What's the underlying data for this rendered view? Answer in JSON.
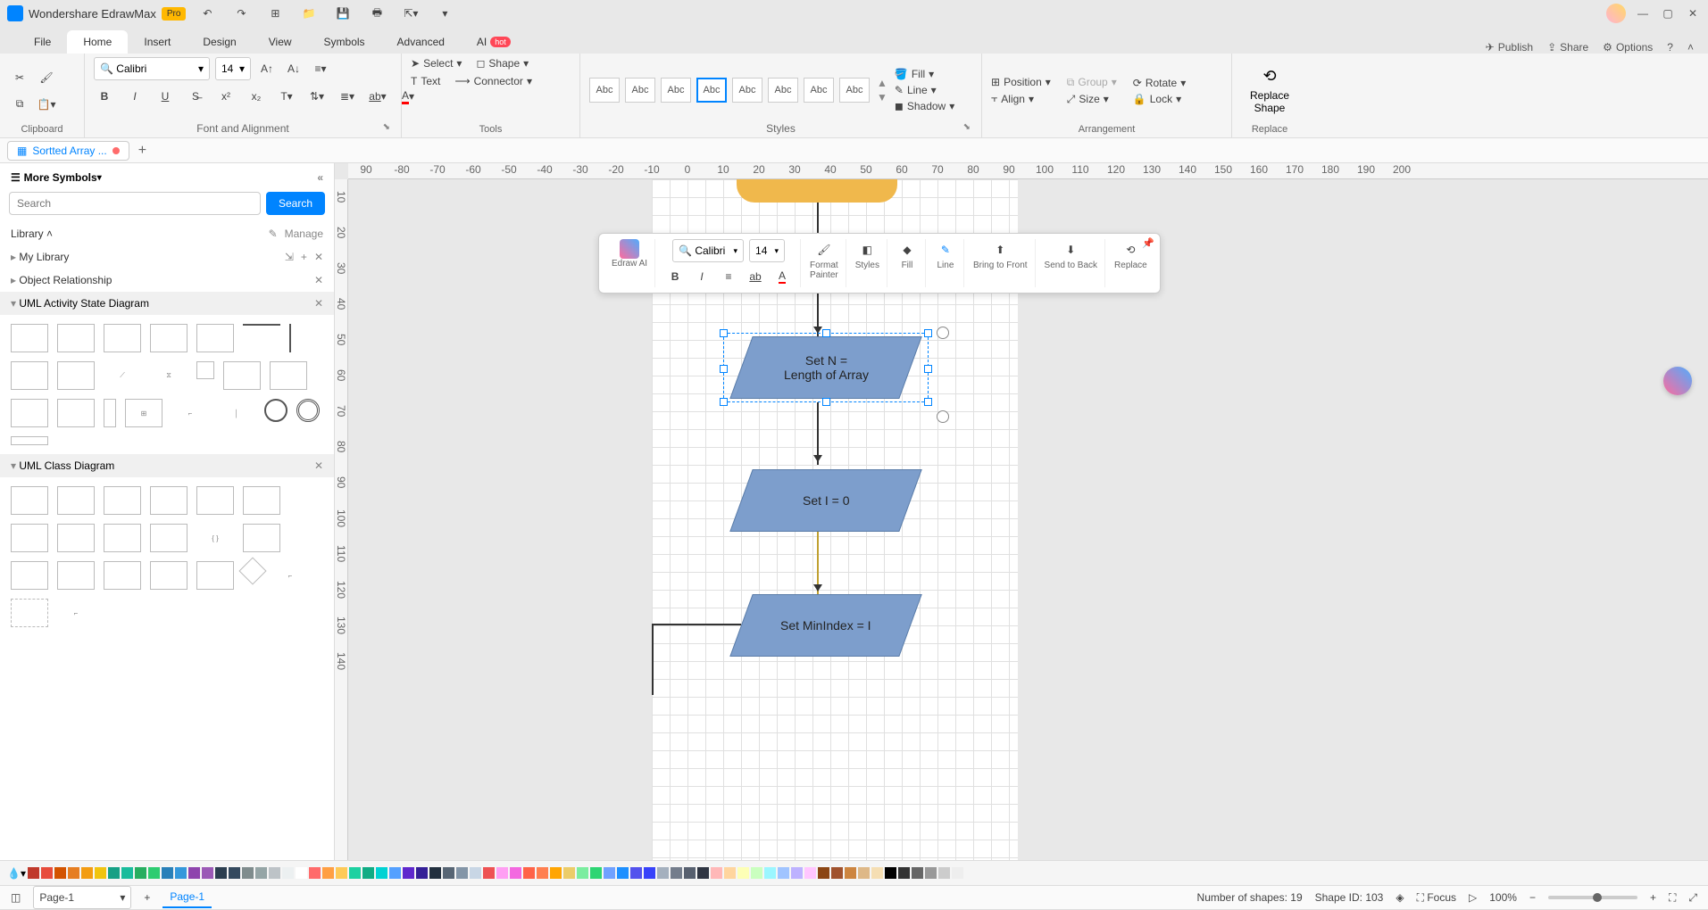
{
  "titlebar": {
    "app_name": "Wondershare EdrawMax",
    "pro": "Pro"
  },
  "menu": {
    "file": "File",
    "home": "Home",
    "insert": "Insert",
    "design": "Design",
    "view": "View",
    "symbols": "Symbols",
    "advanced": "Advanced",
    "ai": "AI",
    "hot": "hot",
    "publish": "Publish",
    "share": "Share",
    "options": "Options"
  },
  "ribbon": {
    "clipboard_label": "Clipboard",
    "font_alignment_label": "Font and Alignment",
    "tools_label": "Tools",
    "styles_label": "Styles",
    "arrangement_label": "Arrangement",
    "replace_label": "Replace",
    "font_name": "Calibri",
    "font_size": "14",
    "select": "Select",
    "text": "Text",
    "shape": "Shape",
    "connector": "Connector",
    "abc": "Abc",
    "fill": "Fill",
    "line": "Line",
    "shadow": "Shadow",
    "position": "Position",
    "align": "Align",
    "group": "Group",
    "size": "Size",
    "rotate": "Rotate",
    "lock": "Lock",
    "replace_shape": "Replace\nShape"
  },
  "doctab": {
    "name": "Sortted Array ..."
  },
  "sidebar": {
    "more_symbols": "More Symbols",
    "search_placeholder": "Search",
    "search_btn": "Search",
    "library": "Library",
    "manage": "Manage",
    "my_library": "My Library",
    "object_relationship": "Object Relationship",
    "uml_activity": "UML Activity State Diagram",
    "uml_class": "UML Class Diagram"
  },
  "ruler_h": [
    "90",
    "-80",
    "-70",
    "-60",
    "-50",
    "-40",
    "-30",
    "-20",
    "-10",
    "0",
    "10",
    "20",
    "30",
    "40",
    "50",
    "60",
    "70",
    "80",
    "90",
    "100",
    "110",
    "120",
    "130",
    "140",
    "150",
    "160",
    "170",
    "180",
    "190",
    "200"
  ],
  "ruler_v": [
    "10",
    "20",
    "30",
    "40",
    "50",
    "60",
    "70",
    "80",
    "90",
    "100",
    "110",
    "120",
    "130",
    "140"
  ],
  "flow": {
    "n1": "Set N =\nLength of Array",
    "n2": "Set I = 0",
    "n3": "Set MinIndex = I"
  },
  "float_tb": {
    "edraw_ai": "Edraw AI",
    "font": "Calibri",
    "size": "14",
    "format_painter": "Format\nPainter",
    "styles": "Styles",
    "fill": "Fill",
    "line": "Line",
    "bring_front": "Bring to Front",
    "send_back": "Send to Back",
    "replace": "Replace"
  },
  "pagebar": {
    "page1": "Page-1",
    "page1_active": "Page-1"
  },
  "status": {
    "shapes": "Number of shapes: 19",
    "shape_id": "Shape ID: 103",
    "focus": "Focus",
    "zoom": "100%"
  },
  "colors": [
    "#c0392b",
    "#e74c3c",
    "#d35400",
    "#e67e22",
    "#f39c12",
    "#f1c40f",
    "#16a085",
    "#1abc9c",
    "#27ae60",
    "#2ecc71",
    "#2980b9",
    "#3498db",
    "#8e44ad",
    "#9b59b6",
    "#2c3e50",
    "#34495e",
    "#7f8c8d",
    "#95a5a6",
    "#bdc3c7",
    "#ecf0f1",
    "#ffffff",
    "#ff6b6b",
    "#ff9f43",
    "#feca57",
    "#1dd1a1",
    "#10ac84",
    "#00d2d3",
    "#54a0ff",
    "#5f27cd",
    "#341f97",
    "#222f3e",
    "#576574",
    "#8395a7",
    "#c8d6e5",
    "#ee5253",
    "#ff9ff3",
    "#f368e0",
    "#ff6348",
    "#ff7f50",
    "#ffa502",
    "#eccc68",
    "#7bed9f",
    "#2ed573",
    "#70a1ff",
    "#1e90ff",
    "#5352ed",
    "#3742fa",
    "#a4b0be",
    "#747d8c",
    "#57606f",
    "#2f3542",
    "#ffb8b8",
    "#ffd59e",
    "#fdffb6",
    "#caffbf",
    "#9bf6ff",
    "#a0c4ff",
    "#bdb2ff",
    "#ffc6ff",
    "#8b4513",
    "#a0522d",
    "#cd853f",
    "#deb887",
    "#f5deb3",
    "#000000",
    "#333333",
    "#666666",
    "#999999",
    "#cccccc",
    "#eeeeee"
  ]
}
